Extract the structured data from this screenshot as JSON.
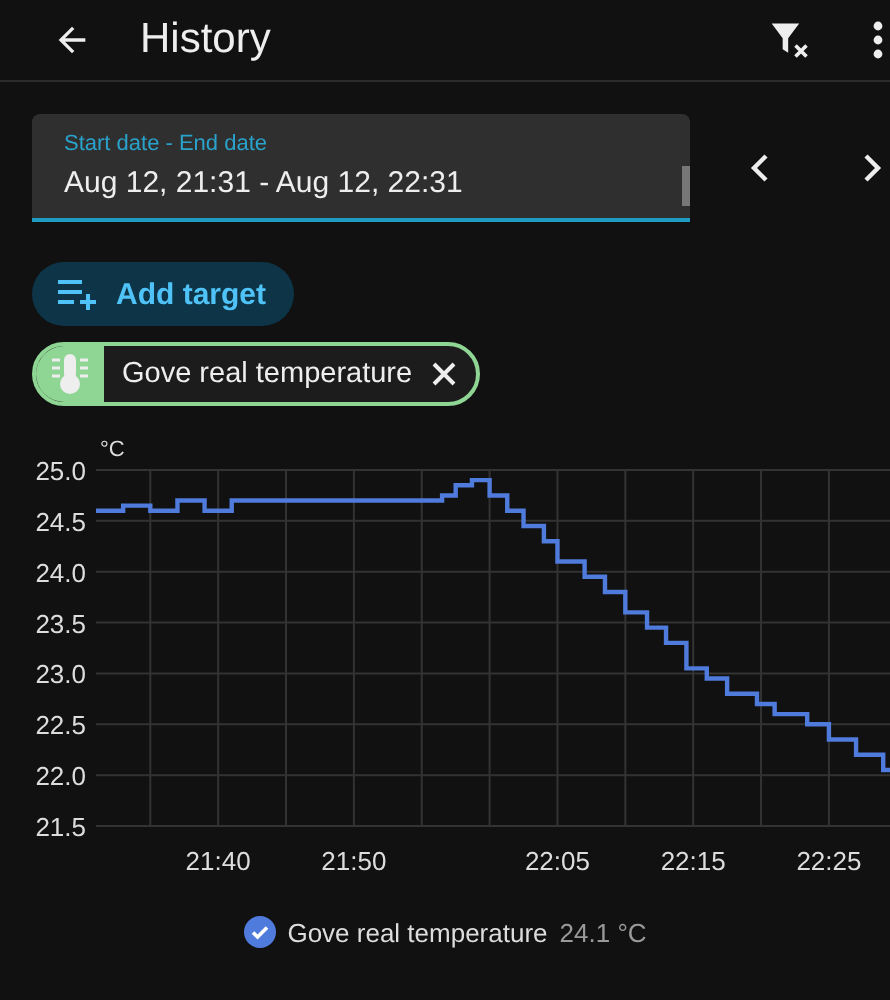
{
  "top_bar": {
    "title": "History"
  },
  "date_range": {
    "label": "Start date - End date",
    "value": "Aug 12, 21:31 - Aug 12, 22:31"
  },
  "add_target": {
    "label": "Add target"
  },
  "target_chips": [
    {
      "label": "Gove real temperature",
      "color": "#8fd694"
    }
  ],
  "chart": {
    "chart_data": {
      "type": "line",
      "ylabel": "°C",
      "grid": true,
      "x": [
        1291,
        1293,
        1293,
        1295,
        1295,
        1297,
        1297,
        1299,
        1299,
        1301,
        1301,
        1316.5,
        1316.5,
        1317.5,
        1317.5,
        1318.7,
        1318.7,
        1320,
        1320,
        1321.3,
        1321.3,
        1322.5,
        1322.5,
        1324,
        1324,
        1325,
        1325,
        1327,
        1327,
        1328.5,
        1328.5,
        1330,
        1330,
        1331.6,
        1331.6,
        1333,
        1333,
        1334.5,
        1334.5,
        1336,
        1336,
        1337.5,
        1337.5,
        1339.7,
        1339.7,
        1341,
        1341,
        1343.4,
        1343.4,
        1345,
        1345,
        1347,
        1347,
        1349,
        1349,
        1349.5
      ],
      "series": [
        {
          "name": "Gove real temperature",
          "color": "#4f7bdc",
          "values": [
            24.6,
            24.6,
            24.65,
            24.65,
            24.6,
            24.6,
            24.7,
            24.7,
            24.6,
            24.6,
            24.7,
            24.7,
            24.75,
            24.75,
            24.85,
            24.85,
            24.9,
            24.9,
            24.75,
            24.75,
            24.6,
            24.6,
            24.45,
            24.45,
            24.3,
            24.3,
            24.1,
            24.1,
            23.95,
            23.95,
            23.8,
            23.8,
            23.6,
            23.6,
            23.45,
            23.45,
            23.3,
            23.3,
            23.05,
            23.05,
            22.95,
            22.95,
            22.8,
            22.8,
            22.7,
            22.7,
            22.6,
            22.6,
            22.5,
            22.5,
            22.35,
            22.35,
            22.2,
            22.2,
            22.05,
            22.05
          ]
        }
      ],
      "xlim": [
        1291,
        1349.5
      ],
      "ylim": [
        21.5,
        25.0
      ],
      "xticks": [
        {
          "value": 1300,
          "label": "21:40"
        },
        {
          "value": 1310,
          "label": "21:50"
        },
        {
          "value": 1325,
          "label": "22:05"
        },
        {
          "value": 1335,
          "label": "22:15"
        },
        {
          "value": 1345,
          "label": "22:25"
        }
      ],
      "yticks": [
        {
          "value": 21.5,
          "label": "21.5"
        },
        {
          "value": 22,
          "label": "22.0"
        },
        {
          "value": 22.5,
          "label": "22.5"
        },
        {
          "value": 23,
          "label": "23.0"
        },
        {
          "value": 23.5,
          "label": "23.5"
        },
        {
          "value": 24,
          "label": "24.0"
        },
        {
          "value": 24.5,
          "label": "24.5"
        },
        {
          "value": 25,
          "label": "25.0"
        }
      ]
    },
    "legend": [
      {
        "reading": "24.1 °C",
        "checked": true
      }
    ]
  }
}
